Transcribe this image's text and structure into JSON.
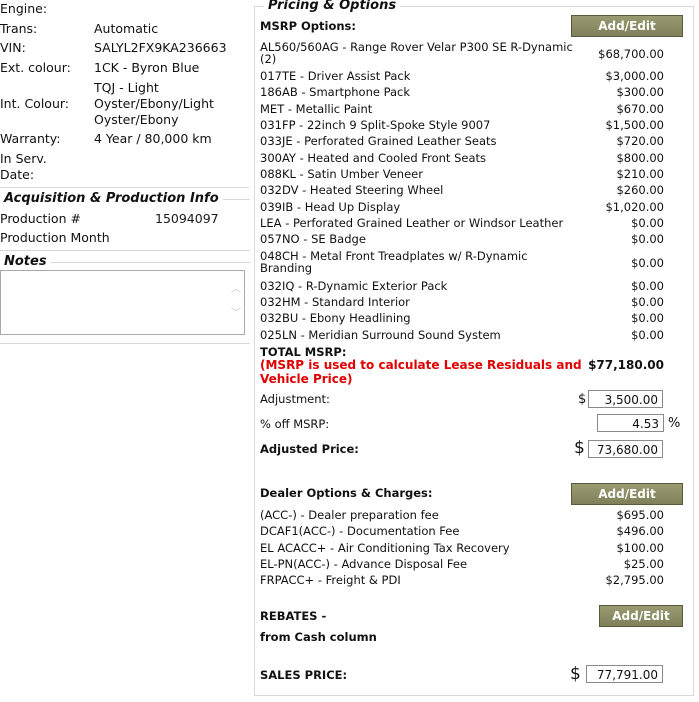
{
  "vehicle": {
    "engine_label": "Engine:",
    "trans_label": "Trans:",
    "trans_value": "Automatic",
    "vin_label": "VIN:",
    "vin_value": "SALYL2FX9KA236663",
    "ext_label": "Ext. colour:",
    "ext_value": "1CK - Byron Blue",
    "int_label": "Int. Colour:",
    "int_value_1": "TQJ - Light",
    "int_value_2": "Oyster/Ebony/Light",
    "int_value_3": "Oyster/Ebony",
    "warranty_label": "Warranty:",
    "warranty_value": "4 Year / 80,000 km",
    "inserv_label_1": "In Serv.",
    "inserv_label_2": "Date:"
  },
  "acquisition": {
    "legend": "Acquisition & Production Info",
    "production_label": "Production #",
    "production_value": "15094097",
    "production_month_label": "Production Month"
  },
  "notes": {
    "legend": "Notes",
    "value": ""
  },
  "pricing": {
    "legend": "Pricing & Options",
    "msrp_options_label": "MSRP Options:",
    "add_edit_label": "Add/Edit",
    "options": [
      {
        "desc": "AL560/560AG - Range Rover Velar P300 SE R-Dynamic",
        "desc2": "(2)",
        "price": "$68,700.00"
      },
      {
        "desc": "017TE - Driver Assist Pack",
        "desc2": "",
        "price": "$3,000.00"
      },
      {
        "desc": "186AB - Smartphone Pack",
        "desc2": "",
        "price": "$300.00"
      },
      {
        "desc": "MET - Metallic Paint",
        "desc2": "",
        "price": "$670.00"
      },
      {
        "desc": "031FP - 22inch 9 Split-Spoke Style 9007",
        "desc2": "",
        "price": "$1,500.00"
      },
      {
        "desc": "033JE - Perforated Grained Leather Seats",
        "desc2": "",
        "price": "$720.00"
      },
      {
        "desc": "300AY - Heated and Cooled Front Seats",
        "desc2": "",
        "price": "$800.00"
      },
      {
        "desc": "088KL - Satin Umber Veneer",
        "desc2": "",
        "price": "$210.00"
      },
      {
        "desc": "032DV - Heated Steering Wheel",
        "desc2": "",
        "price": "$260.00"
      },
      {
        "desc": "039IB - Head Up Display",
        "desc2": "",
        "price": "$1,020.00"
      },
      {
        "desc": "LEA - Perforated Grained Leather or Windsor Leather",
        "desc2": "",
        "price": "$0.00"
      },
      {
        "desc": "057NO - SE Badge",
        "desc2": "",
        "price": "$0.00"
      },
      {
        "desc": "048CH - Metal Front Treadplates w/ R-Dynamic",
        "desc2": "Branding",
        "price": "$0.00"
      },
      {
        "desc": "032IQ - R-Dynamic Exterior Pack",
        "desc2": "",
        "price": "$0.00"
      },
      {
        "desc": "032HM - Standard Interior",
        "desc2": "",
        "price": "$0.00"
      },
      {
        "desc": "032BU - Ebony Headlining",
        "desc2": "",
        "price": "$0.00"
      },
      {
        "desc": "025LN - Meridian Surround Sound System",
        "desc2": "",
        "price": "$0.00"
      }
    ],
    "total_msrp_label": "TOTAL MSRP:",
    "msrp_note_1": "(MSRP is used to calculate Lease Residuals and",
    "msrp_note_2": "Vehicle Price)",
    "total_msrp_value": "$77,180.00",
    "adjustment_label": "Adjustment:",
    "dollar": "$",
    "adjustment_value": "3,500.00",
    "pct_off_label": "% off MSRP:",
    "pct_off_value": "4.53",
    "pct_sign": "%",
    "adjusted_price_label": "Adjusted Price:",
    "adjusted_price_value": "73,680.00",
    "dealer_label": "Dealer Options & Charges:",
    "dealer_items": [
      {
        "desc": "(ACC-) - Dealer preparation fee",
        "price": "$695.00"
      },
      {
        "desc": "DCAF1(ACC-) - Documentation Fee",
        "price": "$496.00"
      },
      {
        "desc": "EL ACACC+ - Air Conditioning Tax Recovery",
        "price": "$100.00"
      },
      {
        "desc": "EL-PN(ACC-) - Advance Disposal Fee",
        "price": "$25.00"
      },
      {
        "desc": "FRPACC+ - Freight & PDI",
        "price": "$2,795.00"
      }
    ],
    "rebates_label": "REBATES -",
    "rebates_sub": "from Cash column",
    "sales_price_label": "SALES PRICE:",
    "sales_price_value": "77,791.00"
  }
}
